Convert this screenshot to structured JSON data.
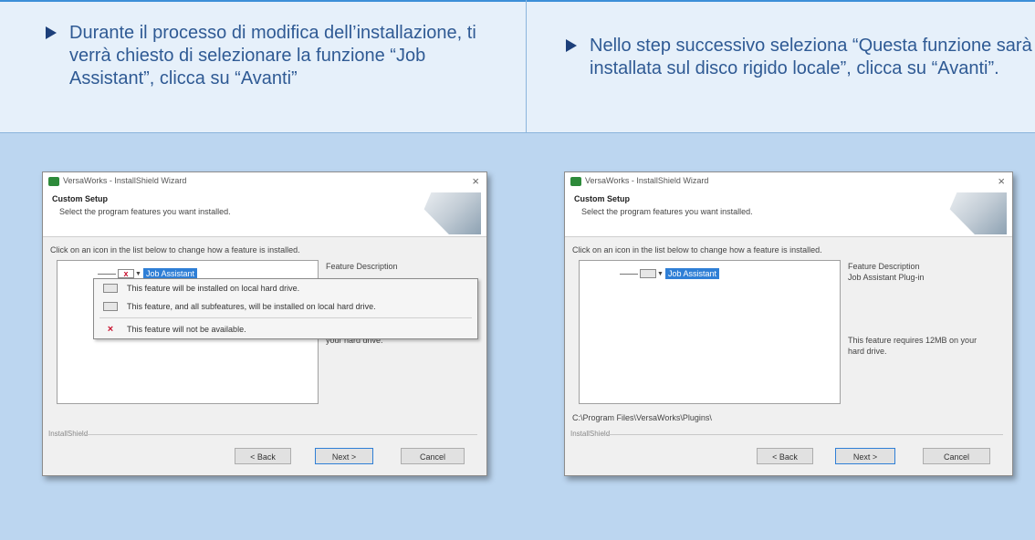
{
  "steps": {
    "left": "Durante il processo di modifica dell’installazione, ti verrà chiesto di selezionare la funzione “Job Assistant”, clicca su “Avanti”",
    "right": "Nello step successivo seleziona “Questa funzione sarà installata sul disco rigido locale”, clicca su “Avanti”."
  },
  "colors": {
    "accent": "#3d8fd8",
    "text_blue": "#2f5a94",
    "band_light": "#e6f0fa",
    "band_blue": "#bcd6f0"
  },
  "dialog1": {
    "title": "VersaWorks - InstallShield Wizard",
    "close": "×",
    "header_title": "Custom Setup",
    "header_sub": "Select the program features you want installed.",
    "instruction": "Click on an icon in the list below to change how a feature is installed.",
    "tree_item": "Job Assistant",
    "desc_title": "Feature Description",
    "desc_note": "your hard drive.",
    "menu": {
      "opt1": "This feature will be installed on local hard drive.",
      "opt2": "This feature, and all subfeatures, will be installed on local hard drive.",
      "opt3": "This feature will not be available."
    },
    "installshield": "InstallShield",
    "back": "< Back",
    "next": "Next >",
    "cancel": "Cancel"
  },
  "dialog2": {
    "title": "VersaWorks - InstallShield Wizard",
    "close": "×",
    "header_title": "Custom Setup",
    "header_sub": "Select the program features you want installed.",
    "instruction": "Click on an icon in the list below to change how a feature is installed.",
    "tree_item": "Job Assistant",
    "desc_title": "Feature Description",
    "desc_sub": "Job Assistant Plug-in",
    "desc_note": "This feature requires 12MB on your hard drive.",
    "path": "C:\\Program Files\\VersaWorks\\Plugins\\",
    "installshield": "InstallShield",
    "back": "< Back",
    "next": "Next >",
    "cancel": "Cancel"
  }
}
